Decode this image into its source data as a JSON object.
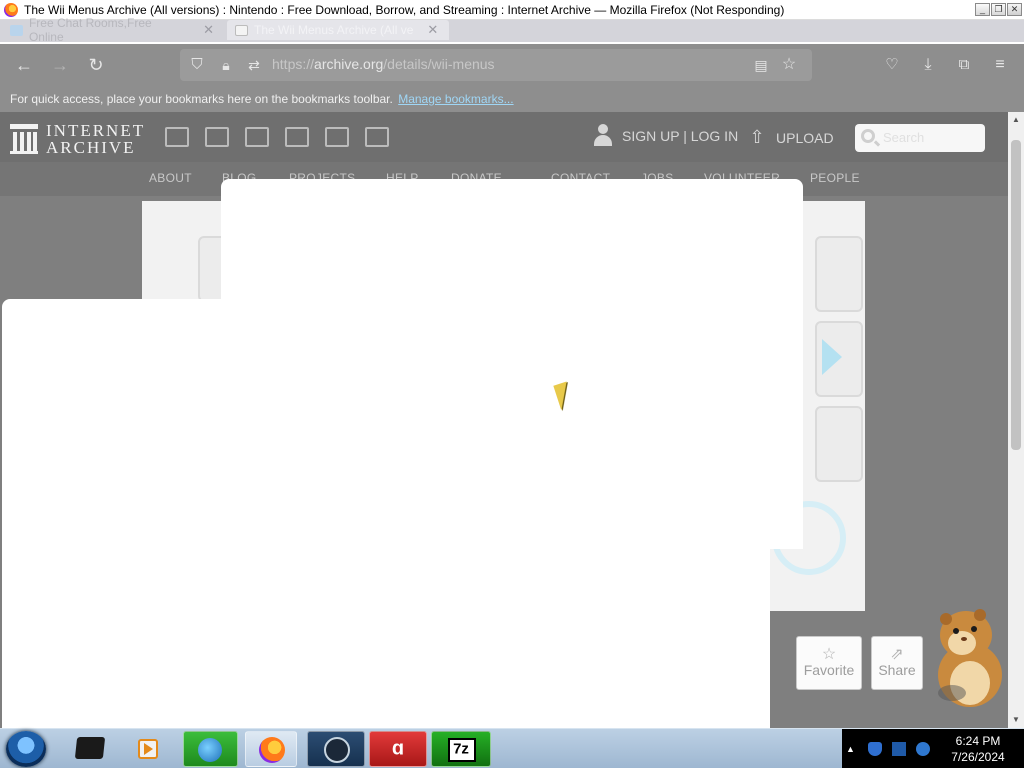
{
  "window": {
    "title": "The Wii Menus Archive (All versions) : Nintendo : Free Download, Borrow, and Streaming : Internet Archive — Mozilla Firefox (Not Responding)"
  },
  "tabs": [
    {
      "label": "Free Chat Rooms,Free Online",
      "active": false
    },
    {
      "label": "The Wii Menus Archive (All ve",
      "active": true
    }
  ],
  "toolbar": {
    "url_prefix": "https://",
    "url_domain": "archive.org",
    "url_path": "/details/wii-menus"
  },
  "bookmarks_bar": {
    "message": "For quick access, place your bookmarks here on the bookmarks toolbar.",
    "manage_link": "Manage bookmarks..."
  },
  "ia_header": {
    "logo_line1": "INTERNET",
    "logo_line2": "ARCHIVE",
    "media_icons": [
      "web-icon",
      "texts-icon",
      "video-icon",
      "audio-icon",
      "software-icon",
      "images-icon"
    ],
    "signup_login": "SIGN UP | LOG IN",
    "upload": "UPLOAD",
    "search_placeholder": "Search"
  },
  "ia_nav": {
    "items": [
      "ABOUT",
      "BLOG",
      "PROJECTS",
      "HELP",
      "DONATE",
      "CONTACT",
      "JOBS",
      "VOLUNTEER",
      "PEOPLE"
    ]
  },
  "actions": {
    "favorite": "Favorite",
    "share": "Share"
  },
  "taskbar": {
    "apps": [
      "console-app-icon",
      "media-player-icon",
      "network-app-icon",
      "firefox-icon",
      "steam-icon",
      "avira-icon",
      "7zip-icon"
    ],
    "sevenzip_label": "7z",
    "time": "6:24 PM",
    "date": "7/26/2024"
  },
  "colors": {
    "dim_overlay": "#7f7f7f",
    "link": "#9fd6f5",
    "taskbar": "#a9c0d9",
    "tray": "#000000"
  }
}
